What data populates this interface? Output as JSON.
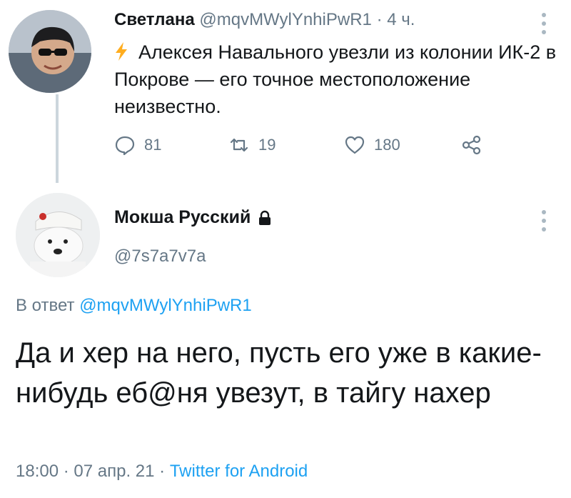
{
  "tweet1": {
    "author_name": "Светлана",
    "author_handle": "@mqvMWylYnhiPwR1",
    "separator": "·",
    "time_ago": "4 ч.",
    "text": "Алексея Навального увезли из колонии ИК-2 в Покрове — его точное местоположение неизвестно.",
    "stats": {
      "replies": "81",
      "retweets": "19",
      "likes": "180"
    },
    "icons": [
      "lightning-icon",
      "reply-icon",
      "retweet-icon",
      "like-icon",
      "share-icon",
      "more-icon"
    ]
  },
  "tweet2": {
    "author_name": "Мокша Русский",
    "author_handle": "@7s7a7v7a",
    "reply_prefix": "В ответ",
    "reply_handle": "@mqvMWylYnhiPwR1",
    "text": "Да и хер на него, пусть его уже в какие-нибудь еб@ня увезут, в тайгу нахер",
    "timestamp": "18:00 · 07 апр. 21 · ",
    "source": "Twitter for Android",
    "icons": [
      "lock-icon",
      "more-icon"
    ]
  },
  "colors": {
    "accent": "#1da1f2",
    "muted": "#657786",
    "text": "#14171a",
    "bolt": "#ffad1f"
  }
}
